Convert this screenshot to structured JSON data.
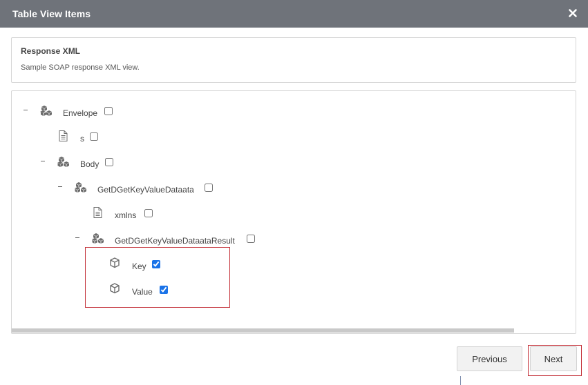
{
  "dialog": {
    "title": "Table View Items",
    "close_label": "✖"
  },
  "info": {
    "heading": "Response XML",
    "description": "Sample SOAP response XML view."
  },
  "tree": [
    {
      "label": "Envelope",
      "icon": "cubes-icon",
      "expanded": true,
      "checked": false
    },
    {
      "label": "s",
      "icon": "document-icon",
      "checked": false
    },
    {
      "label": "Body",
      "icon": "cubes-icon",
      "expanded": true,
      "checked": false
    },
    {
      "label": "GetDGetKeyValueDataata",
      "icon": "cubes-icon",
      "expanded": true,
      "checked": false
    },
    {
      "label": "xmlns",
      "icon": "document-icon",
      "checked": false
    },
    {
      "label": "GetDGetKeyValueDataataResult",
      "icon": "cubes-icon",
      "expanded": true,
      "checked": false
    },
    {
      "label": "Key",
      "icon": "cube-icon",
      "checked": true
    },
    {
      "label": "Value",
      "icon": "cube-icon",
      "checked": true
    }
  ],
  "buttons": {
    "previous": "Previous",
    "next": "Next"
  },
  "colors": {
    "titlebar": "#6f737a",
    "highlight": "#c4323a",
    "checkbox": "#1a73e8"
  }
}
